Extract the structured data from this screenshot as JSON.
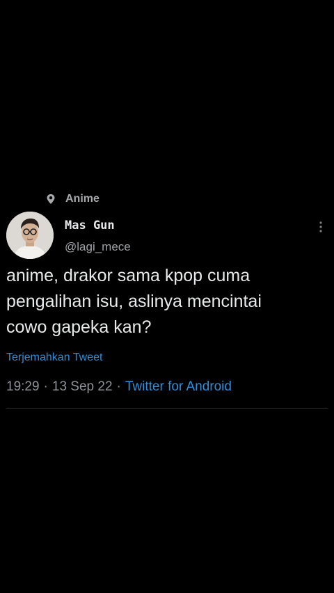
{
  "topic": {
    "label": "Anime",
    "icon": "location-pin-icon"
  },
  "author": {
    "name": "Mas Gun",
    "handle": "@lagi_mece"
  },
  "tweet": {
    "text": "anime, drakor sama kpop cuma\npengalihan isu, aslinya mencintai\ncowo gapeka kan?",
    "translate_label": "Terjemahkan Tweet"
  },
  "meta": {
    "time": "19:29",
    "separator": "·",
    "date": "13 Sep 22",
    "source": "Twitter for Android"
  },
  "colors": {
    "background": "#000000",
    "primary_text": "#e7e9ea",
    "secondary_text": "#8f9297",
    "link": "#2d8fd9"
  }
}
